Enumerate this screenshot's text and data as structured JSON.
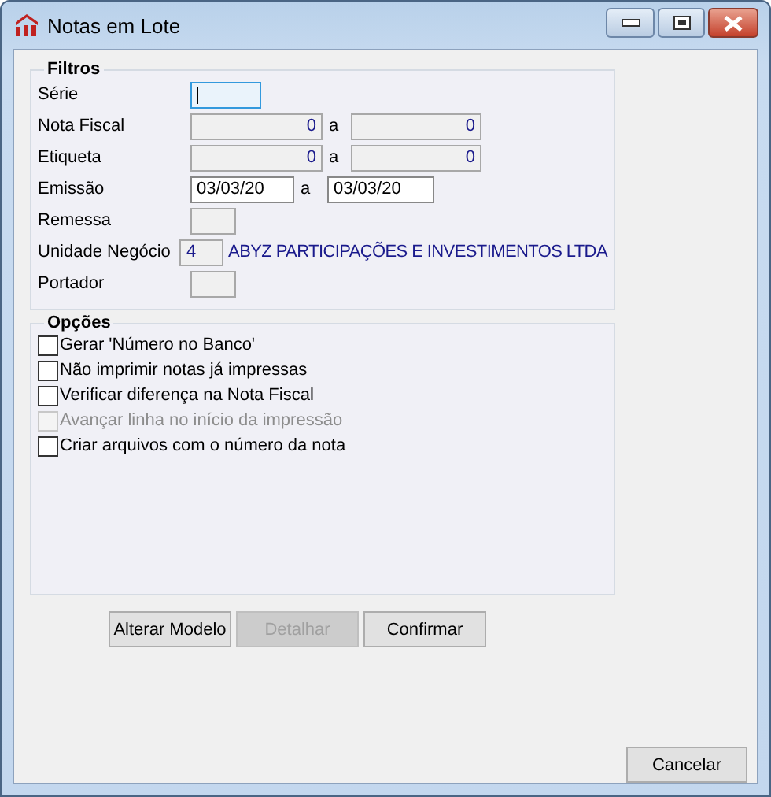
{
  "window": {
    "title": "Notas em Lote"
  },
  "filters": {
    "title": "Filtros",
    "rows": [
      {
        "kind": "series",
        "label": "Série",
        "focused": true
      },
      {
        "kind": "range",
        "label": "Nota Fiscal",
        "from": "0",
        "separator": "a",
        "to": "0"
      },
      {
        "kind": "range",
        "label": "Etiqueta",
        "from": "0",
        "separator": "a",
        "to": "0"
      },
      {
        "kind": "date_range",
        "label": "Emissão",
        "from": "03/03/20",
        "separator": "a",
        "to": "03/03/20"
      },
      {
        "kind": "code",
        "label": "Remessa"
      },
      {
        "kind": "lookup",
        "label": "Unidade Negócio",
        "value": "4",
        "description": "ABYZ PARTICIPAÇÕES E INVESTIMENTOS LTDA"
      },
      {
        "kind": "code",
        "label": "Portador"
      }
    ]
  },
  "options": {
    "title": "Opções",
    "items": [
      {
        "label": "Gerar 'Número no Banco'",
        "checked": false,
        "disabled": false
      },
      {
        "label": "Não imprimir notas já impressas",
        "checked": false,
        "disabled": false
      },
      {
        "label": "Verificar diferença na Nota Fiscal",
        "checked": false,
        "disabled": false
      },
      {
        "label": "Avançar linha no início da impressão",
        "checked": false,
        "disabled": true
      },
      {
        "label": "Criar arquivos com o número da nota",
        "checked": false,
        "disabled": false
      }
    ]
  },
  "buttons": [
    {
      "label": "Alterar Modelo",
      "disabled": false
    },
    {
      "label": "Detalhar",
      "disabled": true
    },
    {
      "label": "Confirmar",
      "disabled": false
    }
  ],
  "cancel_button": {
    "label": "Cancelar",
    "disabled": false
  }
}
